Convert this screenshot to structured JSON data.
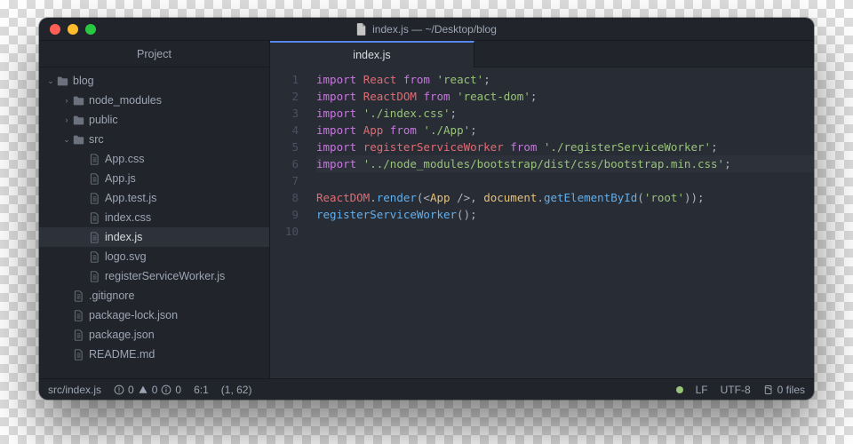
{
  "window": {
    "title": "index.js — ~/Desktop/blog"
  },
  "sidebar": {
    "title": "Project",
    "rows": [
      {
        "depth": 0,
        "kind": "folder",
        "open": true,
        "label": "blog"
      },
      {
        "depth": 1,
        "kind": "folder",
        "open": false,
        "label": "node_modules"
      },
      {
        "depth": 1,
        "kind": "folder",
        "open": false,
        "label": "public"
      },
      {
        "depth": 1,
        "kind": "folder",
        "open": true,
        "label": "src"
      },
      {
        "depth": 2,
        "kind": "file",
        "label": "App.css"
      },
      {
        "depth": 2,
        "kind": "file",
        "label": "App.js"
      },
      {
        "depth": 2,
        "kind": "file",
        "label": "App.test.js"
      },
      {
        "depth": 2,
        "kind": "file",
        "label": "index.css"
      },
      {
        "depth": 2,
        "kind": "file",
        "label": "index.js",
        "selected": true
      },
      {
        "depth": 2,
        "kind": "file",
        "label": "logo.svg"
      },
      {
        "depth": 2,
        "kind": "file",
        "label": "registerServiceWorker.js"
      },
      {
        "depth": 1,
        "kind": "file",
        "label": ".gitignore"
      },
      {
        "depth": 1,
        "kind": "file",
        "label": "package-lock.json"
      },
      {
        "depth": 1,
        "kind": "file",
        "label": "package.json"
      },
      {
        "depth": 1,
        "kind": "file",
        "label": "README.md"
      }
    ]
  },
  "tabs": [
    {
      "label": "index.js",
      "active": true
    }
  ],
  "code": {
    "highlight_line": 6,
    "lines": [
      [
        {
          "c": "kw",
          "t": "import"
        },
        {
          "c": "pn",
          "t": " "
        },
        {
          "c": "cls",
          "t": "React"
        },
        {
          "c": "pn",
          "t": " "
        },
        {
          "c": "kw",
          "t": "from"
        },
        {
          "c": "pn",
          "t": " "
        },
        {
          "c": "str",
          "t": "'react'"
        },
        {
          "c": "pn",
          "t": ";"
        }
      ],
      [
        {
          "c": "kw",
          "t": "import"
        },
        {
          "c": "pn",
          "t": " "
        },
        {
          "c": "cls",
          "t": "ReactDOM"
        },
        {
          "c": "pn",
          "t": " "
        },
        {
          "c": "kw",
          "t": "from"
        },
        {
          "c": "pn",
          "t": " "
        },
        {
          "c": "str",
          "t": "'react-dom'"
        },
        {
          "c": "pn",
          "t": ";"
        }
      ],
      [
        {
          "c": "kw",
          "t": "import"
        },
        {
          "c": "pn",
          "t": " "
        },
        {
          "c": "str",
          "t": "'./index.css'"
        },
        {
          "c": "pn",
          "t": ";"
        }
      ],
      [
        {
          "c": "kw",
          "t": "import"
        },
        {
          "c": "pn",
          "t": " "
        },
        {
          "c": "cls",
          "t": "App"
        },
        {
          "c": "pn",
          "t": " "
        },
        {
          "c": "kw",
          "t": "from"
        },
        {
          "c": "pn",
          "t": " "
        },
        {
          "c": "str",
          "t": "'./App'"
        },
        {
          "c": "pn",
          "t": ";"
        }
      ],
      [
        {
          "c": "kw",
          "t": "import"
        },
        {
          "c": "pn",
          "t": " "
        },
        {
          "c": "cls",
          "t": "registerServiceWorker"
        },
        {
          "c": "pn",
          "t": " "
        },
        {
          "c": "kw",
          "t": "from"
        },
        {
          "c": "pn",
          "t": " "
        },
        {
          "c": "str",
          "t": "'./registerServiceWorker'"
        },
        {
          "c": "pn",
          "t": ";"
        }
      ],
      [
        {
          "c": "kw",
          "t": "import"
        },
        {
          "c": "pn",
          "t": " "
        },
        {
          "c": "str",
          "t": "'../node_modules/bootstrap/dist/css/bootstrap.min.css'"
        },
        {
          "c": "pn",
          "t": ";"
        }
      ],
      [],
      [
        {
          "c": "cls",
          "t": "ReactDOM"
        },
        {
          "c": "pn",
          "t": "."
        },
        {
          "c": "fn",
          "t": "render"
        },
        {
          "c": "pn",
          "t": "(<"
        },
        {
          "c": "obj",
          "t": "App"
        },
        {
          "c": "pn",
          "t": " />, "
        },
        {
          "c": "obj",
          "t": "document"
        },
        {
          "c": "pn",
          "t": "."
        },
        {
          "c": "fn",
          "t": "getElementById"
        },
        {
          "c": "pn",
          "t": "("
        },
        {
          "c": "str",
          "t": "'root'"
        },
        {
          "c": "pn",
          "t": "));"
        }
      ],
      [
        {
          "c": "fn",
          "t": "registerServiceWorker"
        },
        {
          "c": "pn",
          "t": "();"
        }
      ],
      []
    ]
  },
  "status": {
    "path": "src/index.js",
    "errors": "0",
    "warnings": "0",
    "info": "0",
    "cursor": "6:1",
    "selection": "(1, 62)",
    "line_ending": "LF",
    "encoding": "UTF-8",
    "git_files": "0 files"
  }
}
